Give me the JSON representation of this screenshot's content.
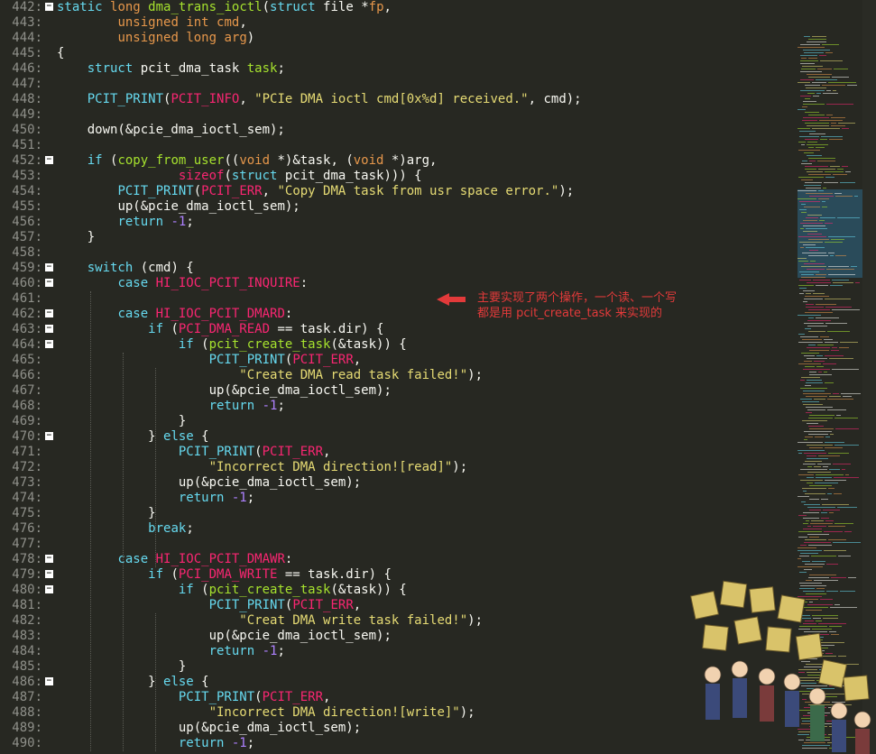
{
  "colors": {
    "background": "#272822",
    "keyword": "#66d9ef",
    "type": "#e6974b",
    "function": "#a6e22e",
    "string": "#e6db74",
    "number": "#ae81ff",
    "macro": "#f92672",
    "plain": "#f8f8f2",
    "line_number": "#8f908a",
    "annotation": "#e23a3a"
  },
  "editor": {
    "lines": [
      {
        "no": "442:",
        "fold": true,
        "indent": 0,
        "tokens": [
          [
            "k",
            "static"
          ],
          [
            "p",
            " "
          ],
          [
            "t",
            "long"
          ],
          [
            "p",
            " "
          ],
          [
            "f",
            "dma_trans_ioctl"
          ],
          [
            "p",
            "("
          ],
          [
            "k",
            "struct"
          ],
          [
            "p",
            " file *"
          ],
          [
            "t",
            "fp"
          ],
          [
            "p",
            ","
          ]
        ]
      },
      {
        "no": "443:",
        "fold": false,
        "indent": 8,
        "tokens": [
          [
            "t",
            "unsigned"
          ],
          [
            "p",
            " "
          ],
          [
            "t",
            "int"
          ],
          [
            "p",
            " "
          ],
          [
            "t",
            "cmd"
          ],
          [
            "p",
            ","
          ]
        ]
      },
      {
        "no": "444:",
        "fold": false,
        "indent": 8,
        "tokens": [
          [
            "t",
            "unsigned"
          ],
          [
            "p",
            " "
          ],
          [
            "t",
            "long"
          ],
          [
            "p",
            " "
          ],
          [
            "t",
            "arg"
          ],
          [
            "p",
            ")"
          ]
        ]
      },
      {
        "no": "445:",
        "fold": false,
        "indent": 0,
        "tokens": [
          [
            "p",
            "{"
          ]
        ]
      },
      {
        "no": "446:",
        "fold": false,
        "indent": 4,
        "tokens": [
          [
            "k",
            "struct"
          ],
          [
            "p",
            " pcit_dma_task "
          ],
          [
            "f",
            "task"
          ],
          [
            "p",
            ";"
          ]
        ]
      },
      {
        "no": "447:",
        "fold": false,
        "indent": 0,
        "tokens": []
      },
      {
        "no": "448:",
        "fold": false,
        "indent": 4,
        "tokens": [
          [
            "k",
            "PCIT_PRINT"
          ],
          [
            "p",
            "("
          ],
          [
            "m",
            "PCIT_INFO"
          ],
          [
            "p",
            ", "
          ],
          [
            "s",
            "\"PCIe DMA ioctl cmd[0x%d] received.\""
          ],
          [
            "p",
            ", cmd);"
          ]
        ]
      },
      {
        "no": "449:",
        "fold": false,
        "indent": 0,
        "tokens": []
      },
      {
        "no": "450:",
        "fold": false,
        "indent": 4,
        "tokens": [
          [
            "p",
            "down(&pcie_dma_ioctl_sem);"
          ]
        ]
      },
      {
        "no": "451:",
        "fold": false,
        "indent": 0,
        "tokens": []
      },
      {
        "no": "452:",
        "fold": true,
        "indent": 4,
        "tokens": [
          [
            "k",
            "if"
          ],
          [
            "p",
            " ("
          ],
          [
            "f",
            "copy_from_user"
          ],
          [
            "p",
            "(("
          ],
          [
            "t",
            "void"
          ],
          [
            "p",
            " *)&task, ("
          ],
          [
            "t",
            "void"
          ],
          [
            "p",
            " *)arg,"
          ]
        ]
      },
      {
        "no": "453:",
        "fold": false,
        "indent": 16,
        "tokens": [
          [
            "m",
            "sizeof"
          ],
          [
            "p",
            "("
          ],
          [
            "k",
            "struct"
          ],
          [
            "p",
            " pcit_dma_task))) {"
          ]
        ]
      },
      {
        "no": "454:",
        "fold": false,
        "indent": 8,
        "tokens": [
          [
            "k",
            "PCIT_PRINT"
          ],
          [
            "p",
            "("
          ],
          [
            "m",
            "PCIT_ERR"
          ],
          [
            "p",
            ", "
          ],
          [
            "s",
            "\"Copy DMA task from usr space error.\""
          ],
          [
            "p",
            ");"
          ]
        ]
      },
      {
        "no": "455:",
        "fold": false,
        "indent": 8,
        "tokens": [
          [
            "p",
            "up(&pcie_dma_ioctl_sem);"
          ]
        ]
      },
      {
        "no": "456:",
        "fold": false,
        "indent": 8,
        "tokens": [
          [
            "k",
            "return"
          ],
          [
            "p",
            " "
          ],
          [
            "n",
            "-1"
          ],
          [
            "p",
            ";"
          ]
        ]
      },
      {
        "no": "457:",
        "fold": false,
        "indent": 4,
        "tokens": [
          [
            "p",
            "}"
          ]
        ]
      },
      {
        "no": "458:",
        "fold": false,
        "indent": 0,
        "tokens": []
      },
      {
        "no": "459:",
        "fold": true,
        "indent": 4,
        "tokens": [
          [
            "k",
            "switch"
          ],
          [
            "p",
            " (cmd) {"
          ]
        ]
      },
      {
        "no": "460:",
        "fold": true,
        "indent": 8,
        "tokens": [
          [
            "k",
            "case"
          ],
          [
            "p",
            " "
          ],
          [
            "m",
            "HI_IOC_PCIT_INQUIRE"
          ],
          [
            "p",
            ":"
          ]
        ]
      },
      {
        "no": "461:",
        "fold": false,
        "indent": 0,
        "tokens": []
      },
      {
        "no": "462:",
        "fold": true,
        "indent": 8,
        "tokens": [
          [
            "k",
            "case"
          ],
          [
            "p",
            " "
          ],
          [
            "m",
            "HI_IOC_PCIT_DMARD"
          ],
          [
            "p",
            ":"
          ]
        ]
      },
      {
        "no": "463:",
        "fold": true,
        "indent": 12,
        "tokens": [
          [
            "k",
            "if"
          ],
          [
            "p",
            " ("
          ],
          [
            "m",
            "PCI_DMA_READ"
          ],
          [
            "p",
            " == task.dir) {"
          ]
        ]
      },
      {
        "no": "464:",
        "fold": true,
        "indent": 16,
        "tokens": [
          [
            "k",
            "if"
          ],
          [
            "p",
            " ("
          ],
          [
            "f",
            "pcit_create_task"
          ],
          [
            "p",
            "(&task)) {"
          ]
        ]
      },
      {
        "no": "465:",
        "fold": false,
        "indent": 20,
        "tokens": [
          [
            "k",
            "PCIT_PRINT"
          ],
          [
            "p",
            "("
          ],
          [
            "m",
            "PCIT_ERR"
          ],
          [
            "p",
            ","
          ]
        ]
      },
      {
        "no": "466:",
        "fold": false,
        "indent": 24,
        "tokens": [
          [
            "s",
            "\"Create DMA read task failed!\""
          ],
          [
            "p",
            ");"
          ]
        ]
      },
      {
        "no": "467:",
        "fold": false,
        "indent": 20,
        "tokens": [
          [
            "p",
            "up(&pcie_dma_ioctl_sem);"
          ]
        ]
      },
      {
        "no": "468:",
        "fold": false,
        "indent": 20,
        "tokens": [
          [
            "k",
            "return"
          ],
          [
            "p",
            " "
          ],
          [
            "n",
            "-1"
          ],
          [
            "p",
            ";"
          ]
        ]
      },
      {
        "no": "469:",
        "fold": false,
        "indent": 16,
        "tokens": [
          [
            "p",
            "}"
          ]
        ]
      },
      {
        "no": "470:",
        "fold": true,
        "indent": 12,
        "tokens": [
          [
            "p",
            "} "
          ],
          [
            "k",
            "else"
          ],
          [
            "p",
            " {"
          ]
        ]
      },
      {
        "no": "471:",
        "fold": false,
        "indent": 16,
        "tokens": [
          [
            "k",
            "PCIT_PRINT"
          ],
          [
            "p",
            "("
          ],
          [
            "m",
            "PCIT_ERR"
          ],
          [
            "p",
            ","
          ]
        ]
      },
      {
        "no": "472:",
        "fold": false,
        "indent": 20,
        "tokens": [
          [
            "s",
            "\"Incorrect DMA direction![read]\""
          ],
          [
            "p",
            ");"
          ]
        ]
      },
      {
        "no": "473:",
        "fold": false,
        "indent": 16,
        "tokens": [
          [
            "p",
            "up(&pcie_dma_ioctl_sem);"
          ]
        ]
      },
      {
        "no": "474:",
        "fold": false,
        "indent": 16,
        "tokens": [
          [
            "k",
            "return"
          ],
          [
            "p",
            " "
          ],
          [
            "n",
            "-1"
          ],
          [
            "p",
            ";"
          ]
        ]
      },
      {
        "no": "475:",
        "fold": false,
        "indent": 12,
        "tokens": [
          [
            "p",
            "}"
          ]
        ]
      },
      {
        "no": "476:",
        "fold": false,
        "indent": 12,
        "tokens": [
          [
            "k",
            "break"
          ],
          [
            "p",
            ";"
          ]
        ]
      },
      {
        "no": "477:",
        "fold": false,
        "indent": 0,
        "tokens": []
      },
      {
        "no": "478:",
        "fold": true,
        "indent": 8,
        "tokens": [
          [
            "k",
            "case"
          ],
          [
            "p",
            " "
          ],
          [
            "m",
            "HI_IOC_PCIT_DMAWR"
          ],
          [
            "p",
            ":"
          ]
        ]
      },
      {
        "no": "479:",
        "fold": true,
        "indent": 12,
        "tokens": [
          [
            "k",
            "if"
          ],
          [
            "p",
            " ("
          ],
          [
            "m",
            "PCI_DMA_WRITE"
          ],
          [
            "p",
            " == task.dir) {"
          ]
        ]
      },
      {
        "no": "480:",
        "fold": true,
        "indent": 16,
        "tokens": [
          [
            "k",
            "if"
          ],
          [
            "p",
            " ("
          ],
          [
            "f",
            "pcit_create_task"
          ],
          [
            "p",
            "(&task)) {"
          ]
        ]
      },
      {
        "no": "481:",
        "fold": false,
        "indent": 20,
        "tokens": [
          [
            "k",
            "PCIT_PRINT"
          ],
          [
            "p",
            "("
          ],
          [
            "m",
            "PCIT_ERR"
          ],
          [
            "p",
            ","
          ]
        ]
      },
      {
        "no": "482:",
        "fold": false,
        "indent": 24,
        "tokens": [
          [
            "s",
            "\"Creat DMA write task failed!\""
          ],
          [
            "p",
            ");"
          ]
        ]
      },
      {
        "no": "483:",
        "fold": false,
        "indent": 20,
        "tokens": [
          [
            "p",
            "up(&pcie_dma_ioctl_sem);"
          ]
        ]
      },
      {
        "no": "484:",
        "fold": false,
        "indent": 20,
        "tokens": [
          [
            "k",
            "return"
          ],
          [
            "p",
            " "
          ],
          [
            "n",
            "-1"
          ],
          [
            "p",
            ";"
          ]
        ]
      },
      {
        "no": "485:",
        "fold": false,
        "indent": 16,
        "tokens": [
          [
            "p",
            "}"
          ]
        ]
      },
      {
        "no": "486:",
        "fold": true,
        "indent": 12,
        "tokens": [
          [
            "p",
            "} "
          ],
          [
            "k",
            "else"
          ],
          [
            "p",
            " {"
          ]
        ]
      },
      {
        "no": "487:",
        "fold": false,
        "indent": 16,
        "tokens": [
          [
            "k",
            "PCIT_PRINT"
          ],
          [
            "p",
            "("
          ],
          [
            "m",
            "PCIT_ERR"
          ],
          [
            "p",
            ","
          ]
        ]
      },
      {
        "no": "488:",
        "fold": false,
        "indent": 20,
        "tokens": [
          [
            "s",
            "\"Incorrect DMA direction![write]\""
          ],
          [
            "p",
            ");"
          ]
        ]
      },
      {
        "no": "489:",
        "fold": false,
        "indent": 16,
        "tokens": [
          [
            "p",
            "up(&pcie_dma_ioctl_sem);"
          ]
        ]
      },
      {
        "no": "490:",
        "fold": false,
        "indent": 16,
        "tokens": [
          [
            "k",
            "return"
          ],
          [
            "p",
            " "
          ],
          [
            "n",
            "-1"
          ],
          [
            "p",
            ";"
          ]
        ]
      }
    ]
  },
  "annotation": {
    "line1": "主要实现了两个操作，一个读、一个写",
    "line2": "都是用 pcit_create_task 来实现的"
  },
  "minimap": {
    "label": "minimap"
  },
  "decoration": {
    "icon": "cartoon-crowd-icon"
  }
}
